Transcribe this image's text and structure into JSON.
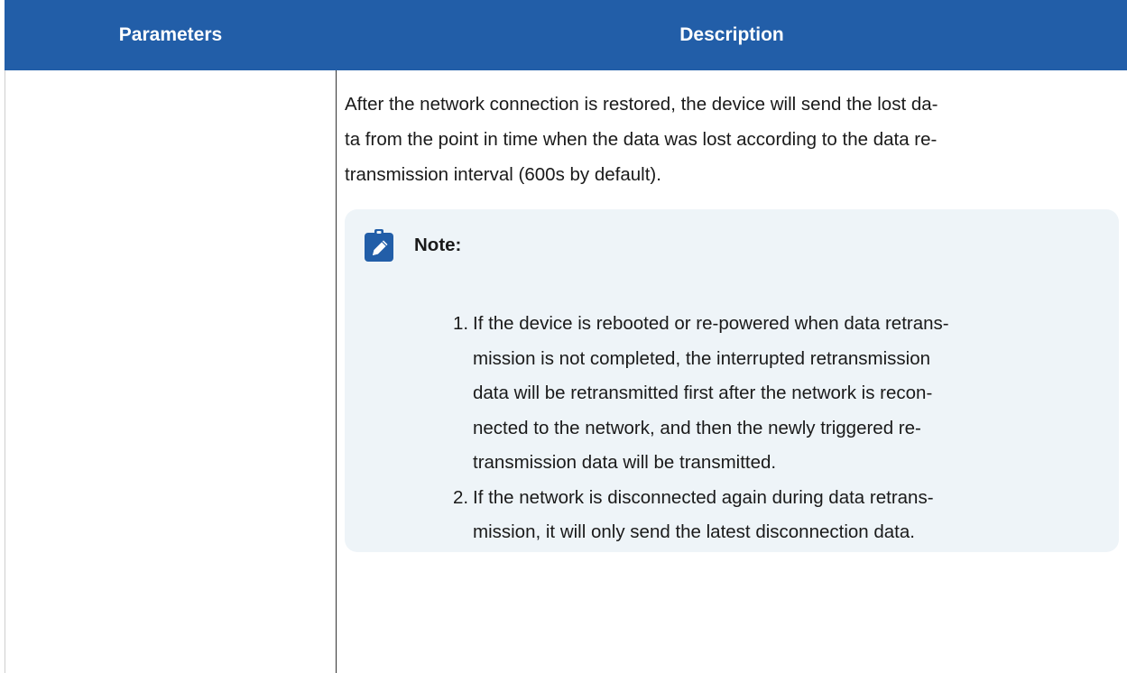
{
  "table": {
    "headers": {
      "parameters": "Parameters",
      "description": "Description"
    }
  },
  "row": {
    "parameter": "",
    "description_lines": [
      "After the network connection is restored, the device will send the lost da-",
      "ta from the point in time when the data was lost according to the data re-",
      "transmission interval (600s by default)."
    ]
  },
  "note": {
    "icon": "pencil-icon",
    "title": "Note:",
    "items": [
      {
        "number": "1.",
        "lines": [
          "If the device is rebooted or re-powered when data retrans-",
          "mission is not completed, the interrupted retransmission",
          "data will be retransmitted first after the network is recon-",
          "nected to the network, and then the newly triggered re-",
          "transmission data will be transmitted."
        ]
      },
      {
        "number": "2.",
        "lines": [
          "If the network is disconnected again during data retrans-",
          "mission, it will only send the latest disconnection data."
        ]
      }
    ]
  },
  "colors": {
    "header_bg": "#225ea8",
    "header_text": "#ffffff",
    "note_bg": "#eef4f8",
    "icon_bg": "#225ea8"
  }
}
